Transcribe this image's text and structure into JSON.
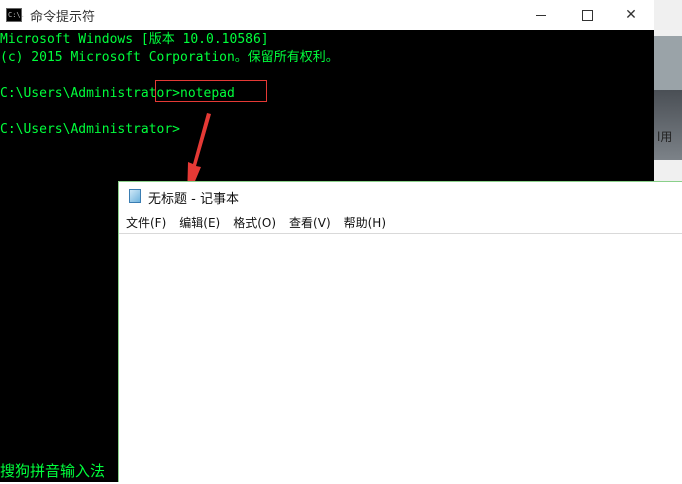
{
  "cmd": {
    "title": "命令提示符",
    "line1": "Microsoft Windows [版本 10.0.10586]",
    "line2": "(c) 2015 Microsoft Corporation。保留所有权利。",
    "line3": "C:\\Users\\Administrator>notepad",
    "line4": "C:\\Users\\Administrator>",
    "ime_status": "搜狗拼音输入法",
    "text_color": "#00ff3c",
    "background": "#000000",
    "icon_label": "C:\\."
  },
  "notepad": {
    "title": "无标题 - 记事本",
    "menu": [
      "文件(F)",
      "编辑(E)",
      "格式(O)",
      "查看(V)",
      "帮助(H)"
    ],
    "content": ""
  },
  "background_window": {
    "fragment_text": "l用"
  },
  "annotation": {
    "color": "#e53935"
  }
}
